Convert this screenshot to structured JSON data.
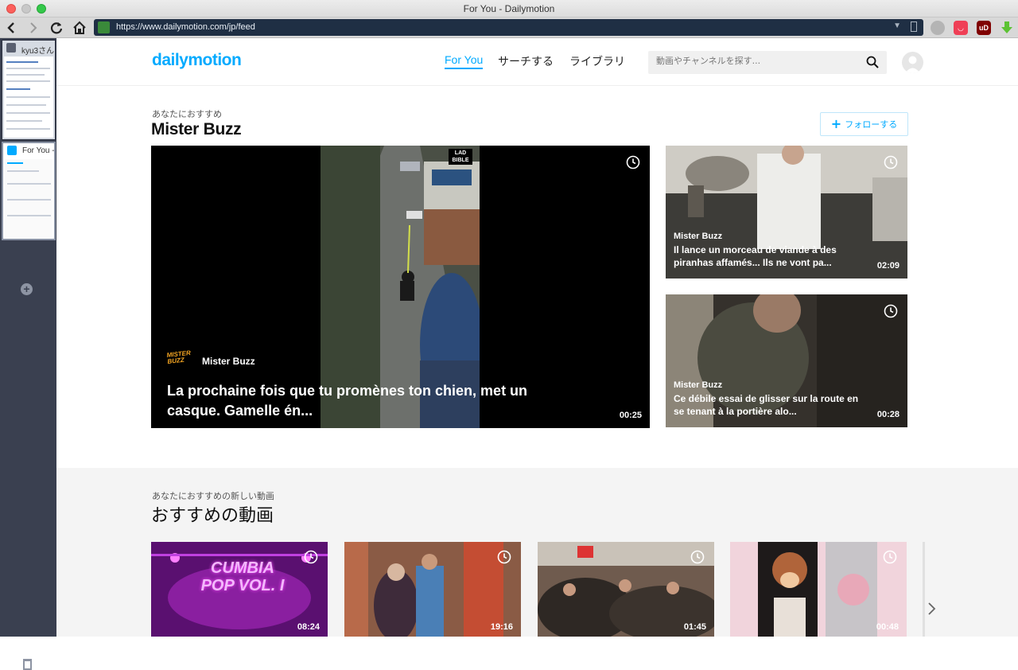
{
  "window": {
    "title": "For You - Dailymotion"
  },
  "browser": {
    "url": "https://www.dailymotion.com/jp/feed"
  },
  "tabs": [
    {
      "label": "kyu3さん"
    },
    {
      "label": "For You -"
    }
  ],
  "header": {
    "logo": "dailymotion",
    "nav": [
      "For You",
      "サーチする",
      "ライブラリ"
    ],
    "search_placeholder": "動画やチャンネルを探す..."
  },
  "featured": {
    "subtitle": "あなたにおすすめ",
    "title": "Mister Buzz",
    "follow_label": "フォローする",
    "main_video": {
      "channel": "Mister Buzz",
      "title": "La prochaine fois que tu promènes ton chien, met un casque. Gamelle én...",
      "duration": "00:25",
      "badge": "LAD BIBLE",
      "channel_logo": "MISTER BUZZ"
    },
    "side_videos": [
      {
        "channel": "Mister Buzz",
        "title": "Il lance un morceau de viande à des piranhas affamés... Ils ne vont pa...",
        "duration": "02:09"
      },
      {
        "channel": "Mister Buzz",
        "title": "Ce débile essai de glisser sur la route en se tenant à la portière alo...",
        "duration": "00:28"
      }
    ]
  },
  "recommended": {
    "subtitle": "あなたにおすすめの新しい動画",
    "title": "おすすめの動画",
    "videos": [
      {
        "duration": "08:24",
        "thumb_text": "CUMBIA POP VOL. I"
      },
      {
        "duration": "19:16"
      },
      {
        "duration": "01:45"
      },
      {
        "duration": "00:48"
      }
    ]
  },
  "colors": {
    "brand": "#00aaff",
    "dark": "#111111"
  }
}
